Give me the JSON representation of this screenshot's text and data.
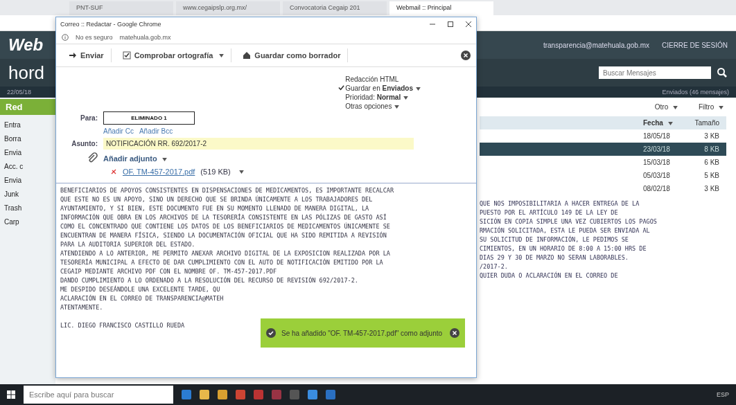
{
  "browser": {
    "tabs": [
      {
        "label": "PNT-SUF",
        "selected": false
      },
      {
        "label": "www.cegaipslp.org.mx/",
        "selected": false
      },
      {
        "label": "Convocatoria Cegaip 201",
        "selected": false
      },
      {
        "label": "Webmail :: Principal",
        "selected": true
      }
    ]
  },
  "webmail": {
    "logo": "Web",
    "user_email": "transparencia@matehuala.gob.mx",
    "logout": "CIERRE DE SESIÓN",
    "brand": "hord",
    "date": "22/05/18",
    "compose": "Red",
    "search_placeholder": "Buscar Mensajes",
    "folder_title": "Enviados (46 mensajes)",
    "sidebar": [
      {
        "label": "Entra"
      },
      {
        "label": "Borra"
      },
      {
        "label": "Envia"
      },
      {
        "label": "Acc. c"
      },
      {
        "label": "Envia"
      },
      {
        "label": "Junk"
      },
      {
        "label": "Trash"
      },
      {
        "label": "Carp"
      }
    ],
    "list_menus": [
      "Otro",
      "Filtro"
    ],
    "columns": [
      "Fecha",
      "Tamaño"
    ],
    "rows": [
      {
        "date": "18/05/18",
        "size": "3 KB",
        "selected": false
      },
      {
        "date": "23/03/18",
        "size": "8 KB",
        "selected": true
      },
      {
        "date": "15/03/18",
        "size": "6 KB",
        "selected": false
      },
      {
        "date": "05/03/18",
        "size": "5 KB",
        "selected": false
      },
      {
        "date": "08/02/18",
        "size": "3 KB",
        "selected": false
      }
    ],
    "preview_lines": [
      "QUE NOS IMPOSIBILITARIA A HACER ENTREGA DE LA",
      "PUESTO POR EL ARTÍCULO 149 DE LA LEY DE",
      "SICIÓN EN COPIA SIMPLE UNA VEZ CUBIERTOS LOS PAGOS",
      "RMACIÓN SOLICITADA, ESTA LE PUEDA SER ENVIADA AL",
      "SU SOLICITUD DE INFORMACIÓN, LE PEDIMOS SE",
      "CIMIENTOS, EN UN HORARIO DE 8:00 A 15:00 HRS DE",
      "DIAS 29 Y 30 DE MARZO NO SERAN LABORABLES.",
      "/2017-2.",
      "QUIER DUDA O ACLARACIÓN EN EL CORREO DE"
    ]
  },
  "popup": {
    "title": "Correo :: Redactar - Google Chrome",
    "security": "No es seguro",
    "url": "matehuala.gob.mx",
    "toolbar": [
      {
        "kind": "send",
        "label": "Enviar"
      },
      {
        "kind": "spell",
        "label": "Comprobar ortografía"
      },
      {
        "kind": "draft",
        "label": "Guardar como borrador"
      }
    ],
    "options": [
      {
        "text": "Redacción HTML",
        "checked": false,
        "menu": false
      },
      {
        "text": "Guardar en **Enviados**",
        "checked": true,
        "menu": true
      },
      {
        "text": "Prioridad: **Normal**",
        "checked": false,
        "menu": true
      },
      {
        "text": "Otras opciones",
        "checked": false,
        "menu": true
      }
    ],
    "to_label": "Para:",
    "to_value": "ELIMINADO 1",
    "add_cc": "Añadir Cc",
    "add_bcc": "Añadir Bcc",
    "subject_label": "Asunto:",
    "subject": "NOTIFICACIÓN RR. 692/2017-2",
    "attach_label": "Añadir adjunto",
    "attachment": {
      "name": "OF. TM-457-2017.pdf",
      "size": "(519 KB)"
    },
    "body_lines": [
      "BENEFICIARIOS DE APOYOS CONSISTENTES EN DISPENSACIONES DE MEDICAMENTOS, ES IMPORTANTE RECALCAR",
      "QUE ESTE NO ES UN APOYO, SINO UN DERECHO QUE SE BRINDA ÚNICAMENTE A LOS TRABAJADORES DEL",
      "AYUNTAMIENTO, Y SI BIEN, ESTE DOCUMENTO FUE EN SU MOMENTO LLENADO DE MANERA DIGITAL, LA",
      "INFORMACIÓN QUE OBRA EN LOS ARCHIVOS DE LA TESORERÍA CONSISTENTE EN LAS PÓLIZAS DE GASTO ASÍ",
      "COMO EL CONCENTRADO QUE CONTIENE LOS DATOS DE LOS BENEFICIARIOS DE MEDICAMENTOS ÚNICAMENTE SE",
      "ENCUENTRAN DE MANERA FÍSICA, SIENDO LA DOCUMENTACIÓN OFICIAL QUE HA SIDO REMITIDA A REVISIÓN",
      "PARA LA AUDITORIA SUPERIOR DEL ESTADO.",
      "ATENDIENDO A LO ANTERIOR, ME PERMITO ANEXAR ARCHIVO DIGITAL DE LA EXPOSICION REALIZADA POR LA",
      "TESORERÍA MUNICIPAL A EFECTO DE DAR CUMPLIMIENTO CON EL AUTO DE NOTIFICACIÓN EMITIDO POR LA",
      "CEGAIP MEDIANTE ARCHIVO PDF CON EL NOMBRE OF. TM-457-2017.PDF",
      "DANDO CUMPLIMIENTO A LO ORDENADO A LA RESOLUCIÓN DEL RECURSO DE REVISIÓN 692/2017-2.",
      "ME DESPIDO DESEÁNDOLE UNA EXCELENTE TARDE, QU",
      "ACLARACIÓN EN EL CORREO DE TRANSPARENCIA@MATEH",
      "ATENTAMENTE."
    ],
    "signature": "LIC. DIEGO FRANCISCO CASTILLO RUEDA",
    "toast": "Se ha añadido \"OF. TM-457-2017.pdf\" como adjunto"
  },
  "taskbar": {
    "search_placeholder": "Escribe aquí para buscar",
    "language": "ESP"
  }
}
